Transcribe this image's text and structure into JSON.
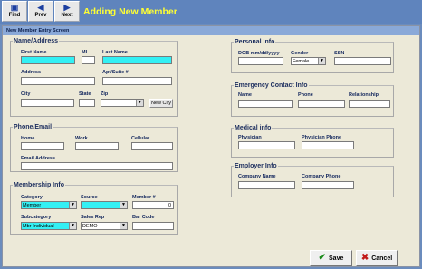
{
  "toolbar": {
    "find": "Find",
    "prev": "Prev",
    "next": "Next",
    "title": "Adding New Member"
  },
  "window": {
    "title": "New Member Entry Screen"
  },
  "name_address": {
    "legend": "Name/Address",
    "first_name": "First Name",
    "mi": "MI",
    "last_name": "Last Name",
    "address": "Address",
    "apt_suite": "Apt/Suite #",
    "city": "City",
    "state": "State",
    "zip": "Zip",
    "new_city": "New City"
  },
  "phone_email": {
    "legend": "Phone/Email",
    "home": "Home",
    "work": "Work",
    "cellular": "Cellular",
    "email": "Email Address"
  },
  "membership": {
    "legend": "Membership Info",
    "category": "Category",
    "category_value": "Member",
    "source": "Source",
    "member_no": "Member #",
    "member_no_value": "0",
    "subcategory": "Subcategory",
    "subcategory_value": "Mbr-Individual",
    "sales_rep": "Sales Rep",
    "sales_rep_value": "DEMO",
    "bar_code": "Bar Code"
  },
  "personal": {
    "legend": "Personal Info",
    "dob": "DOB mm/dd/yyyy",
    "gender": "Gender",
    "gender_value": "Female",
    "ssn": "SSN"
  },
  "emergency": {
    "legend": "Emergency Contact Info",
    "name": "Name",
    "phone": "Phone",
    "relationship": "Relationship"
  },
  "medical": {
    "legend": "Medical info",
    "physician": "Physician",
    "physician_phone": "Physician Phone"
  },
  "employer": {
    "legend": "Employer Info",
    "company_name": "Company Name",
    "company_phone": "Company Phone"
  },
  "actions": {
    "save": "Save",
    "cancel": "Cancel"
  },
  "colors": {
    "required_field": "#33f0f4",
    "title_text": "#ffff33"
  },
  "icons": {
    "find": "binoculars-icon",
    "prev": "arrow-left-icon",
    "next": "arrow-right-icon",
    "save": "checkmark-icon",
    "cancel": "x-icon"
  }
}
